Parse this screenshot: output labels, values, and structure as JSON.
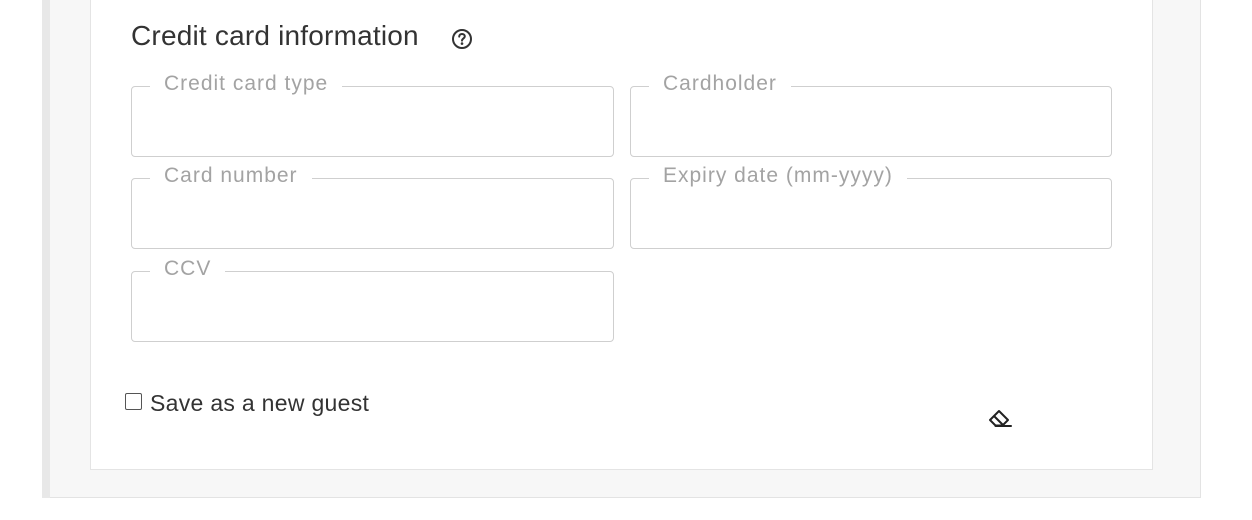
{
  "section": {
    "title": "Credit card information",
    "help_icon": "help-circle-icon"
  },
  "fields": {
    "card_type": {
      "label": "Credit card type",
      "value": ""
    },
    "cardholder": {
      "label": "Cardholder",
      "value": ""
    },
    "card_number": {
      "label": "Card number",
      "value": ""
    },
    "expiry": {
      "label": "Expiry date (mm-yyyy)",
      "value": ""
    },
    "ccv": {
      "label": "CCV",
      "value": ""
    }
  },
  "save_guest": {
    "label": "Save as a new guest",
    "checked": false
  },
  "clear_icon": "eraser-icon",
  "colors": {
    "text": "#333333",
    "label": "#a3a3a3",
    "border": "#cfcfcf",
    "panel_bg": "#f7f7f7"
  }
}
